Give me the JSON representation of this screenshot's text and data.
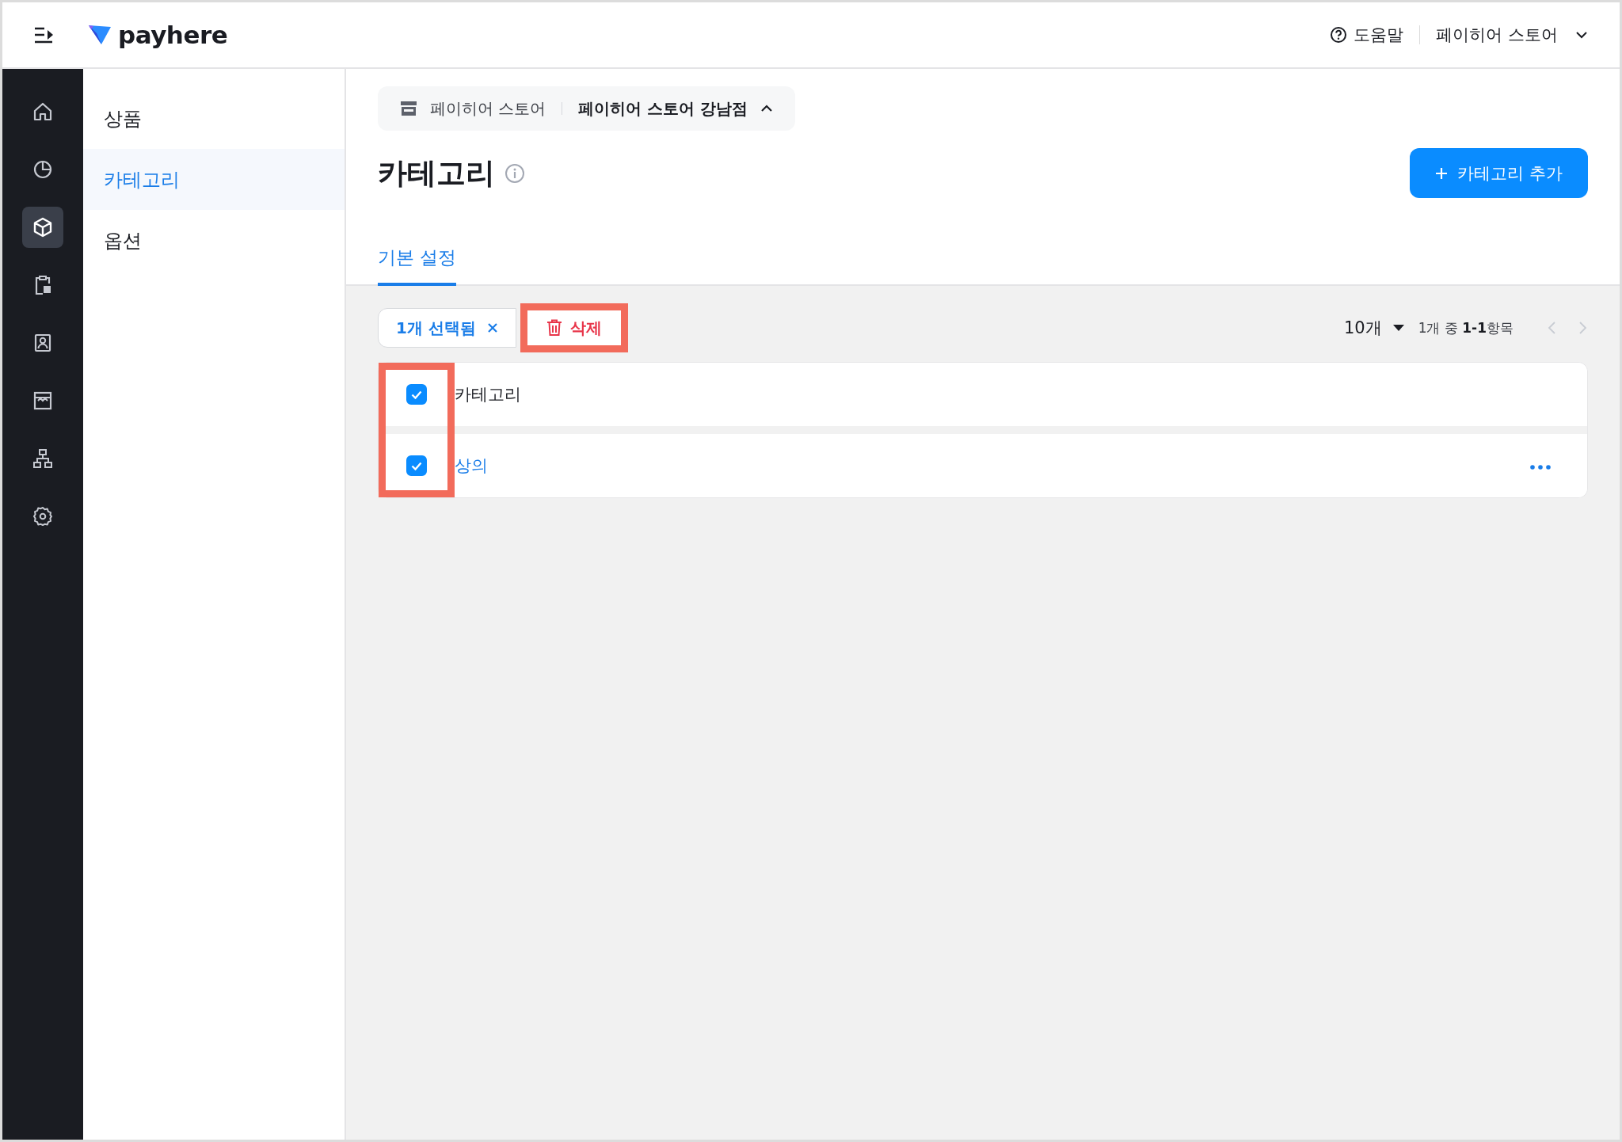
{
  "top_bar": {
    "brand": "payhere",
    "help": "도움말",
    "account": "페이히어 스토어"
  },
  "rail": [
    {
      "selected": false
    },
    {
      "selected": false
    },
    {
      "selected": true
    },
    {
      "selected": false
    },
    {
      "selected": false
    },
    {
      "selected": false
    },
    {
      "selected": false
    },
    {
      "selected": false
    }
  ],
  "submenu": [
    {
      "label": "상품",
      "selected": false
    },
    {
      "label": "카테고리",
      "selected": true
    },
    {
      "label": "옵션",
      "selected": false
    }
  ],
  "breadcrumb": {
    "store": "페이히어 스토어",
    "branch": "페이히어 스토어 강남점",
    "expanded": true
  },
  "page": {
    "title": "카테고리",
    "add_button": "카테고리 추가"
  },
  "tabs": [
    {
      "label": "기본 설정",
      "selected": true
    }
  ],
  "toolbar": {
    "selection": "1개 선택됨",
    "delete": "삭제",
    "delete_highlighted": true,
    "page_size": "10개",
    "range": "1개 중 **1-1**항목"
  },
  "table": {
    "checkbox_column_highlighted": true,
    "rows": [
      {
        "kind": "header",
        "label": "카테고리",
        "checked": true
      },
      {
        "kind": "item",
        "label": "상의",
        "checked": true
      }
    ]
  }
}
